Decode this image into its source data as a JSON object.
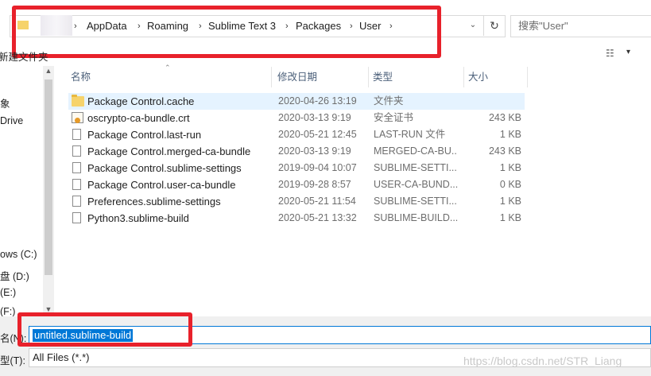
{
  "address": {
    "crumbs": [
      "AppData",
      "Roaming",
      "Sublime Text 3",
      "Packages",
      "User"
    ],
    "separator": "›",
    "refresh_glyph": "↻",
    "dropdown_glyph": "⌄"
  },
  "search": {
    "placeholder": "搜索\"User\""
  },
  "toolbar": {
    "new_folder_label": "新建文件夹",
    "view_glyph": "☷",
    "view_dropdown": "▾"
  },
  "nav": {
    "items": [
      "象",
      "Drive",
      "ows (C:)",
      "盘 (D:)",
      "(E:)",
      "(F:)"
    ]
  },
  "columns": {
    "name": "名称",
    "date": "修改日期",
    "type": "类型",
    "size": "大小"
  },
  "files": [
    {
      "name": "Package Control.cache",
      "date": "2020-04-26 13:19",
      "type": "文件夹",
      "size": "",
      "icon": "folder-icon"
    },
    {
      "name": "oscrypto-ca-bundle.crt",
      "date": "2020-03-13 9:19",
      "type": "安全证书",
      "size": "243 KB",
      "icon": "certificate-icon"
    },
    {
      "name": "Package Control.last-run",
      "date": "2020-05-21 12:45",
      "type": "LAST-RUN 文件",
      "size": "1 KB",
      "icon": "file-icon"
    },
    {
      "name": "Package Control.merged-ca-bundle",
      "date": "2020-03-13 9:19",
      "type": "MERGED-CA-BU...",
      "size": "243 KB",
      "icon": "file-icon"
    },
    {
      "name": "Package Control.sublime-settings",
      "date": "2019-09-04 10:07",
      "type": "SUBLIME-SETTI...",
      "size": "1 KB",
      "icon": "file-icon"
    },
    {
      "name": "Package Control.user-ca-bundle",
      "date": "2019-09-28 8:57",
      "type": "USER-CA-BUND...",
      "size": "0 KB",
      "icon": "file-icon"
    },
    {
      "name": "Preferences.sublime-settings",
      "date": "2020-05-21 11:54",
      "type": "SUBLIME-SETTI...",
      "size": "1 KB",
      "icon": "file-icon"
    },
    {
      "name": "Python3.sublime-build",
      "date": "2020-05-21 13:32",
      "type": "SUBLIME-BUILD...",
      "size": "1 KB",
      "icon": "file-icon"
    }
  ],
  "filename": {
    "label": "名(N):",
    "value": "untitled.sublime-build"
  },
  "filetype": {
    "label": "型(T):",
    "value": "All Files (*.*)"
  },
  "watermark": "https://blog.csdn.net/STR_Liang",
  "colors": {
    "highlight": "#e8212b",
    "selection": "#0078d7",
    "row_selected": "#e5f3ff"
  }
}
